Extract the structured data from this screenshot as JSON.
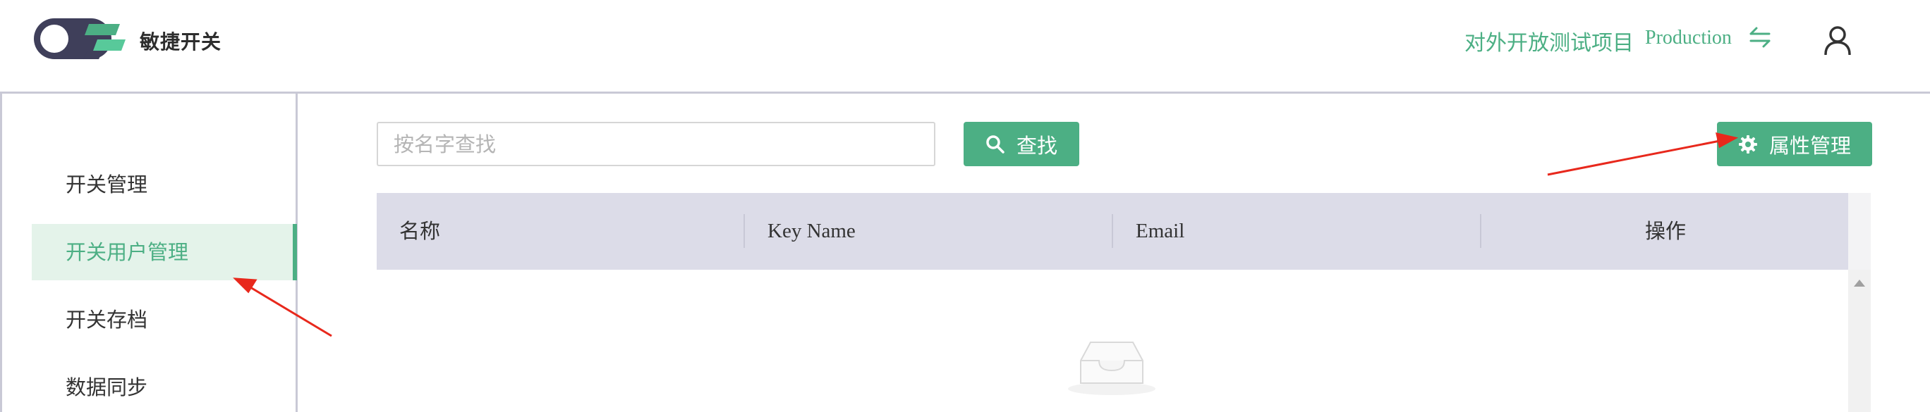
{
  "header": {
    "brand": "敏捷开关",
    "project": "对外开放测试项目",
    "environment": "Production"
  },
  "sidebar": {
    "items": [
      {
        "label": "开关管理",
        "active": false
      },
      {
        "label": "开关用户管理",
        "active": true
      },
      {
        "label": "开关存档",
        "active": false
      },
      {
        "label": "数据同步",
        "active": false
      }
    ]
  },
  "toolbar": {
    "search_placeholder": "按名字查找",
    "search_value": "",
    "search_label": "查找",
    "attr_label": "属性管理"
  },
  "table": {
    "columns": [
      "名称",
      "Key Name",
      "Email",
      "操作"
    ],
    "rows": []
  },
  "colors": {
    "accent": "#4caf84",
    "active_bg": "#e4f3ea",
    "table_header_bg": "#dcdce8",
    "annotation_arrow": "#e8281c"
  },
  "icons": [
    "logo-icon",
    "swap-icon",
    "user-icon",
    "search-icon",
    "gear-icon",
    "empty-inbox-icon"
  ]
}
